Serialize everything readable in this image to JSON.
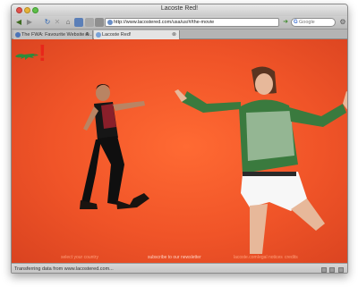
{
  "window": {
    "title": "Lacoste Red!"
  },
  "toolbar": {
    "back_icon": "back-arrow-icon",
    "forward_icon": "forward-arrow-icon",
    "reload_icon": "reload-icon",
    "stop_icon": "stop-icon",
    "home_icon": "home-icon",
    "url": "http://www.lacostered.com/usa/us/#/the-movie",
    "search_placeholder": "Google"
  },
  "tabs": [
    {
      "label": "The FWA: Favourite Website A..."
    },
    {
      "label": "Lacoste Red!"
    }
  ],
  "page": {
    "logo": "crocodile-logo",
    "exclamation": "!",
    "footer_links": [
      "select your country",
      "subscribe to our newsletter",
      "lacoste.com",
      "legal notices",
      "credits"
    ]
  },
  "status": {
    "text": "Transferring data from www.lacostered.com..."
  },
  "colors": {
    "page_background": "#f05428",
    "exclamation": "#e8261a",
    "logo": "#2e8b3a"
  }
}
